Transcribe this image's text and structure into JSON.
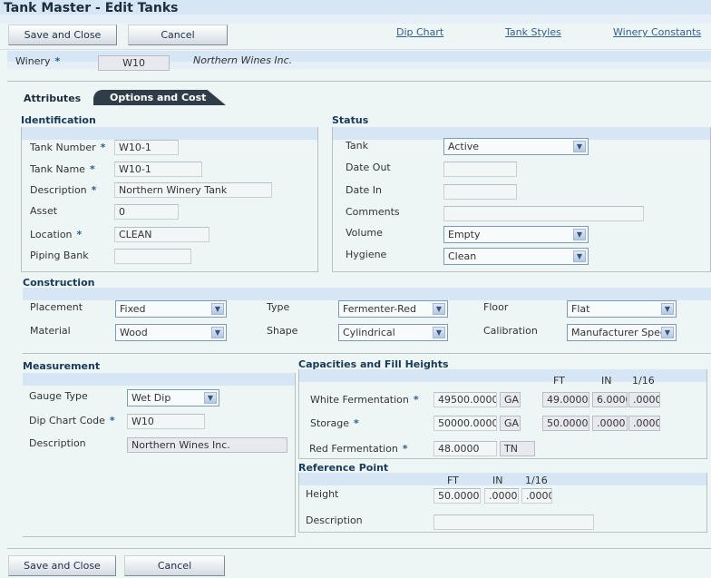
{
  "window": {
    "title": "Tank Master - Edit Tanks"
  },
  "toolbar": {
    "save_close_label": "Save and Close",
    "cancel_label": "Cancel",
    "links": [
      "Dip Chart",
      "Tank Styles",
      "Winery Constants"
    ]
  },
  "header": {
    "winery_label": "Winery",
    "winery_value": "W10",
    "winery_name": "Northern Wines Inc."
  },
  "tabs": [
    {
      "label": "Attributes",
      "active": true
    },
    {
      "label": "Options and Cost",
      "active": false
    }
  ],
  "identification": {
    "title": "Identification",
    "tank_number": {
      "label": "Tank Number",
      "value": "W10-1"
    },
    "tank_name": {
      "label": "Tank Name",
      "value": "W10-1"
    },
    "description": {
      "label": "Description",
      "value": "Northern Winery Tank"
    },
    "asset": {
      "label": "Asset",
      "value": "0"
    },
    "location": {
      "label": "Location",
      "value": "CLEAN"
    },
    "piping_bank": {
      "label": "Piping Bank",
      "value": ""
    }
  },
  "status": {
    "title": "Status",
    "tank": {
      "label": "Tank",
      "value": "Active"
    },
    "date_out": {
      "label": "Date Out",
      "value": ""
    },
    "date_in": {
      "label": "Date In",
      "value": ""
    },
    "comments": {
      "label": "Comments",
      "value": ""
    },
    "volume": {
      "label": "Volume",
      "value": "Empty"
    },
    "hygiene": {
      "label": "Hygiene",
      "value": "Clean"
    }
  },
  "construction": {
    "title": "Construction",
    "placement": {
      "label": "Placement",
      "value": "Fixed"
    },
    "material": {
      "label": "Material",
      "value": "Wood"
    },
    "type": {
      "label": "Type",
      "value": "Fermenter-Red"
    },
    "shape": {
      "label": "Shape",
      "value": "Cylindrical"
    },
    "floor": {
      "label": "Floor",
      "value": "Flat"
    },
    "calibration": {
      "label": "Calibration",
      "value": "Manufacturer Specs"
    }
  },
  "measurement": {
    "title": "Measurement",
    "gauge_type": {
      "label": "Gauge Type",
      "value": "Wet Dip"
    },
    "dip_chart_code": {
      "label": "Dip Chart Code",
      "value": "W10"
    },
    "description": {
      "label": "Description",
      "value": "Northern Wines Inc."
    }
  },
  "capacities": {
    "title": "Capacities and Fill Heights",
    "col_ft": "FT",
    "col_in": "IN",
    "col_16": "1/16",
    "rows": [
      {
        "label": "White Fermentation",
        "value": "49500.0000",
        "uom": "GA",
        "ft": "49.0000",
        "in": "6.0000",
        "sixteenth": ".0000"
      },
      {
        "label": "Storage",
        "value": "50000.0000",
        "uom": "GA",
        "ft": "50.0000",
        "in": ".0000",
        "sixteenth": ".0000"
      },
      {
        "label": "Red Fermentation",
        "value": "48.0000",
        "uom": "TN"
      }
    ]
  },
  "reference_point": {
    "title": "Reference Point",
    "col_ft": "FT",
    "col_in": "IN",
    "col_16": "1/16",
    "height": {
      "label": "Height",
      "ft": "50.0000",
      "in": ".0000",
      "sixteenth": ".0000"
    },
    "description": {
      "label": "Description",
      "value": ""
    }
  },
  "footer": {
    "save_close_label": "Save and Close",
    "cancel_label": "Cancel"
  }
}
